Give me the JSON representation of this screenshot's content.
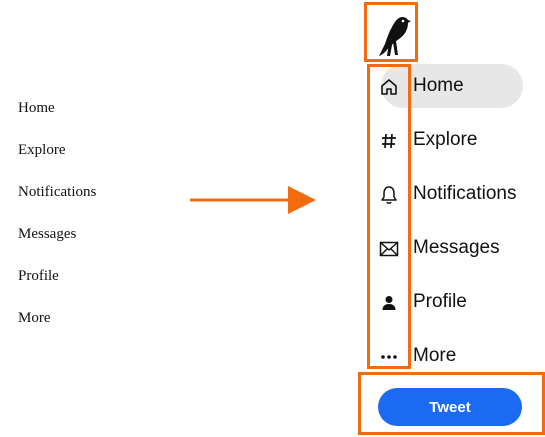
{
  "plain_list": {
    "items": [
      "Home",
      "Explore",
      "Notifications",
      "Messages",
      "Profile",
      "More"
    ]
  },
  "nav": {
    "items": [
      {
        "label": "Home",
        "icon": "home-icon"
      },
      {
        "label": "Explore",
        "icon": "hashtag-icon"
      },
      {
        "label": "Notifications",
        "icon": "bell-icon"
      },
      {
        "label": "Messages",
        "icon": "envelope-icon"
      },
      {
        "label": "Profile",
        "icon": "person-icon"
      },
      {
        "label": "More",
        "icon": "more-icon"
      }
    ],
    "tweet_label": "Tweet"
  },
  "colors": {
    "highlight": "#f26b0f",
    "tweet": "#1d6af2",
    "active_pill": "#e7e7e7"
  }
}
